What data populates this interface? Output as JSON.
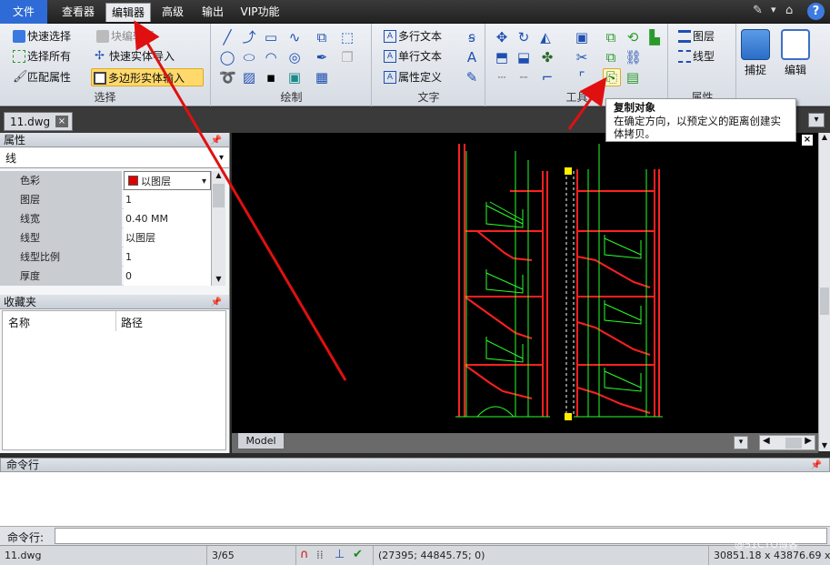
{
  "menu": {
    "file": "文件",
    "items": [
      "查看器",
      "编辑器",
      "高级",
      "输出",
      "VIP功能"
    ],
    "active_index": 1,
    "help": "?"
  },
  "ribbon": {
    "select": {
      "label": "选择",
      "buttons": [
        "快速选择",
        "块编辑器",
        "选择所有",
        "快速实体导入",
        "匹配属性",
        "多边形实体输入"
      ]
    },
    "draw": {
      "label": "绘制"
    },
    "text": {
      "label": "文字",
      "buttons": [
        "多行文本",
        "单行文本",
        "属性定义"
      ]
    },
    "tools": {
      "label": "工具"
    },
    "props": {
      "label": "属性",
      "buttons": [
        "图层",
        "线型"
      ]
    },
    "big_buttons": [
      "捕捉",
      "编辑"
    ]
  },
  "tabs": {
    "doc": "11.dwg",
    "close": "×"
  },
  "properties": {
    "title": "属性",
    "pin": "ᵽ",
    "type": "线",
    "rows": [
      {
        "name": "色彩",
        "value": "以图层"
      },
      {
        "name": "图层",
        "value": "1"
      },
      {
        "name": "线宽",
        "value": "0.40 MM"
      },
      {
        "name": "线型",
        "value": "以图层"
      },
      {
        "name": "线型比例",
        "value": "1"
      },
      {
        "name": "厚度",
        "value": "0"
      }
    ],
    "color_swatch": "#dd0000"
  },
  "favorites": {
    "title": "收藏夹",
    "col_name": "名称",
    "col_path": "路径"
  },
  "model_tab": "Model",
  "tooltip": {
    "title": "复制对象",
    "body": "在确定方向，以预定义的距离创建实体拷贝。"
  },
  "command": {
    "title": "命令行",
    "prompt": "命令行:"
  },
  "status": {
    "file": "11.dwg",
    "page": "3/65",
    "coords": "(27395; 44845.75; 0)",
    "size": "30851.18 x 43876.69 x 1",
    "watermark": "@51CTO博客"
  },
  "colors": {
    "accent": "#2f6bd6",
    "drawing_red": "#ff2020",
    "drawing_green": "#28ff28",
    "annotation_arrow": "#e01010"
  }
}
